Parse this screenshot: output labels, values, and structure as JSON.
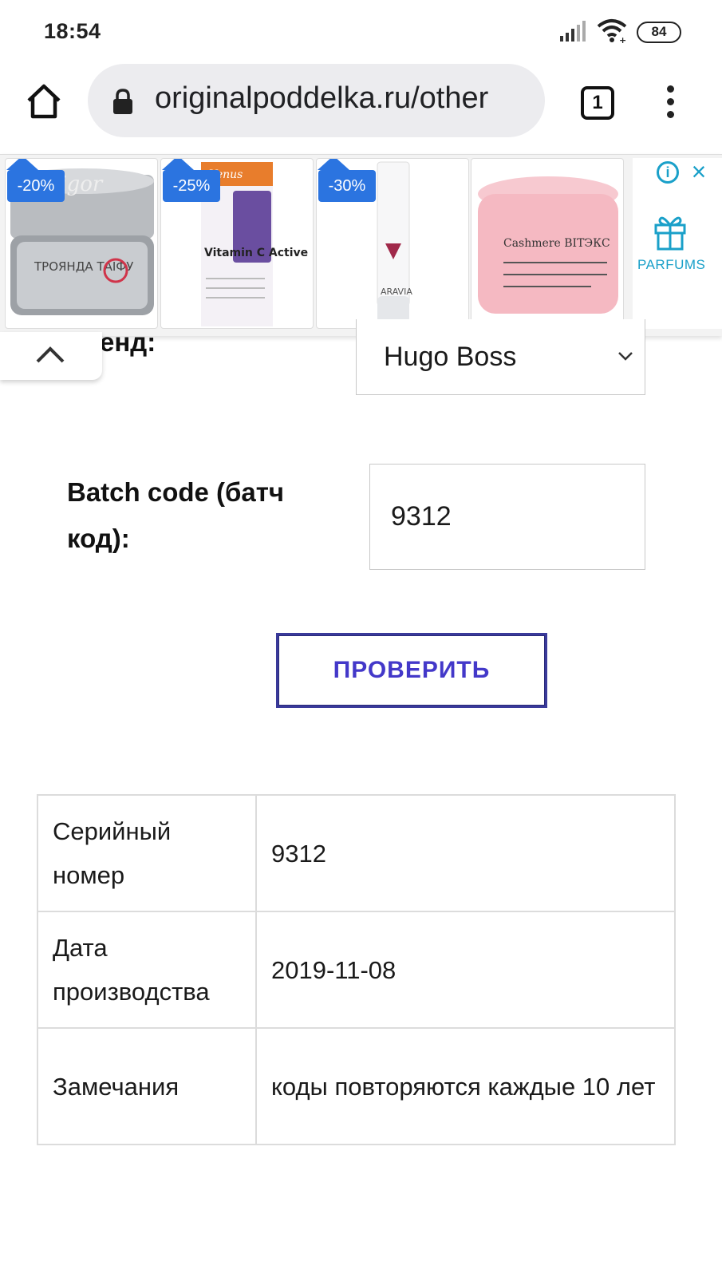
{
  "status_bar": {
    "time": "18:54",
    "battery": "84"
  },
  "browser": {
    "url": "originalpoddelka.ru/other",
    "tab_count": "1"
  },
  "ad": {
    "items": [
      {
        "discount": "-20%",
        "product": "ТРОЯНДА ТАЇФУ"
      },
      {
        "discount": "-25%",
        "product": "Vitamin C Active"
      },
      {
        "discount": "-30%",
        "product": "ARAVIA"
      },
      {
        "product": "Cashmere ВІТЭКС"
      }
    ],
    "side_label": "PARFUMS"
  },
  "form": {
    "brand_label": "енд:",
    "brand_value": "Hugo Boss",
    "batch_label": "Batch code (батч код):",
    "batch_value": "9312",
    "check_button": "ПРОВЕРИТЬ"
  },
  "results": [
    {
      "key": "Серийный номер",
      "value": "9312"
    },
    {
      "key": "Дата производства",
      "value": "2019-11-08"
    },
    {
      "key": "Замечания",
      "value": "коды повторяются каждые 10 лет"
    }
  ]
}
